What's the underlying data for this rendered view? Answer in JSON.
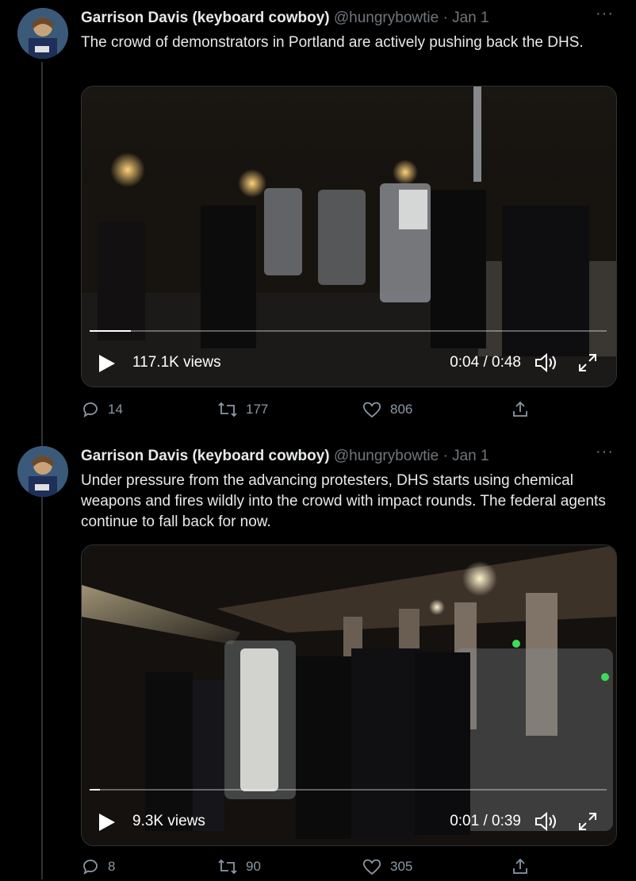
{
  "tweets": [
    {
      "name": "Garrison Davis (keyboard cowboy)",
      "handle": "@hungrybowtie",
      "separator": "·",
      "date": "Jan 1",
      "more": "···",
      "text": "The crowd of demonstrators in Portland are actively pushing back the DHS.",
      "video": {
        "views": "117.1K views",
        "time": "0:04 / 0:48",
        "progress": 0.08
      },
      "actions": {
        "replies": "14",
        "retweets": "177",
        "likes": "806"
      }
    },
    {
      "name": "Garrison Davis (keyboard cowboy)",
      "handle": "@hungrybowtie",
      "separator": "·",
      "date": "Jan 1",
      "more": "···",
      "text": "Under pressure from the advancing protesters, DHS starts using chemical weapons and fires wildly into the crowd with impact rounds. The federal agents continue to fall back for now.",
      "video": {
        "views": "9.3K views",
        "time": "0:01 / 0:39",
        "progress": 0.02
      },
      "actions": {
        "replies": "8",
        "retweets": "90",
        "likes": "305"
      }
    }
  ],
  "colors": {
    "background": "#000000",
    "secondary": "#71767b",
    "text": "#e7e9ea"
  },
  "icons": [
    "avatar",
    "more-icon",
    "play-icon",
    "volume-icon",
    "fullscreen-icon",
    "reply-icon",
    "retweet-icon",
    "like-icon",
    "share-icon"
  ]
}
